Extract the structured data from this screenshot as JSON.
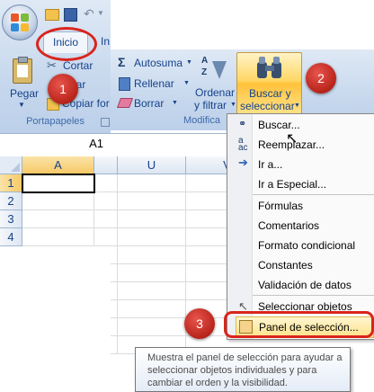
{
  "quick_access": {
    "tab_inicio": "Inicio",
    "tab_next": "In"
  },
  "clipboard": {
    "paste_label": "Pegar",
    "cut_label": "Cortar",
    "copy_label": "iar",
    "format_painter_label": "Copiar for",
    "group_label": "Portapapeles"
  },
  "editing": {
    "autosum_label": "Autosuma",
    "fill_label": "Rellenar",
    "clear_label": "Borrar",
    "sort_label_line1": "Ordenar",
    "sort_label_line2": "y filtrar",
    "find_label_line1": "Buscar y",
    "find_label_line2": "seleccionar",
    "group_label": "Modifica"
  },
  "name_box": {
    "value": "A1"
  },
  "grid": {
    "col_a": "A",
    "col_u": "U",
    "col_v": "V",
    "rows": [
      "1",
      "2",
      "3",
      "4"
    ]
  },
  "menu": {
    "items": [
      {
        "label": "Buscar...",
        "icon": "binoculars-icon"
      },
      {
        "label": "Reemplazar...",
        "icon": "replace-icon"
      },
      {
        "label": "Ir a...",
        "icon": "arrow-right-icon"
      },
      {
        "label": "Ir a Especial...",
        "icon": ""
      },
      {
        "label": "Fórmulas",
        "icon": ""
      },
      {
        "label": "Comentarios",
        "icon": ""
      },
      {
        "label": "Formato condicional",
        "icon": ""
      },
      {
        "label": "Constantes",
        "icon": ""
      },
      {
        "label": "Validación de datos",
        "icon": ""
      },
      {
        "label": "Seleccionar objetos",
        "icon": "cursor-icon"
      },
      {
        "label": "Panel de selección...",
        "icon": "selection-pane-icon"
      }
    ]
  },
  "tooltip": {
    "line1": "Muestra el panel de selección para ayudar a",
    "line2": "seleccionar objetos individuales y para",
    "line3": "cambiar el orden y la visibilidad."
  },
  "callouts": {
    "one": "1",
    "two": "2",
    "three": "3"
  },
  "colors": {
    "accent_red": "#d9251c",
    "ribbon_blue": "#15428b",
    "highlight": "#ffe28a"
  }
}
